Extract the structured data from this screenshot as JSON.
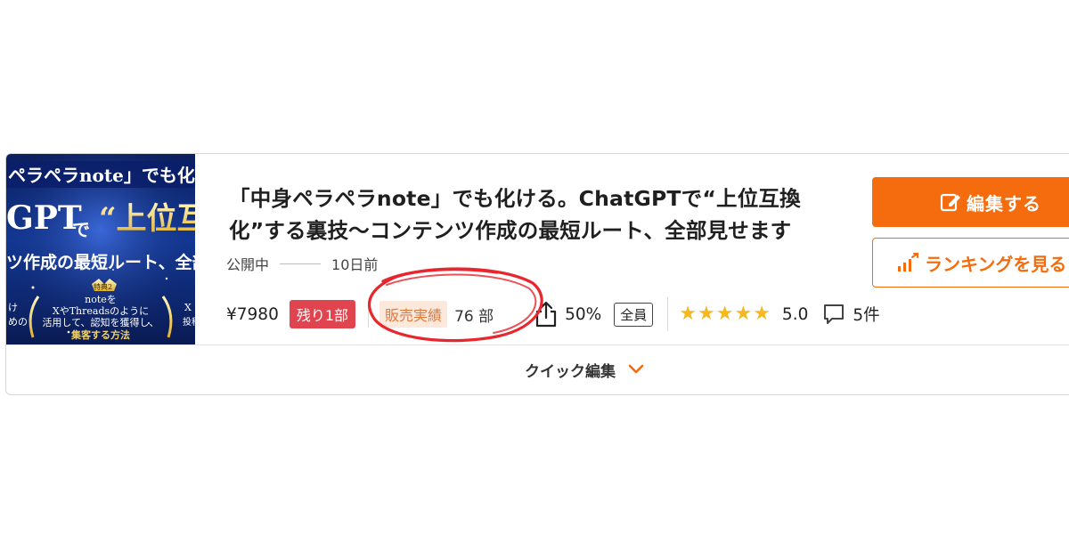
{
  "thumbnail": {
    "line1": "ペラペラnote」でも化",
    "line2": "GPT",
    "line2b": "で",
    "line2c": "“上位互",
    "line3": "ツ作成の最短ルート、全部",
    "line4": "noteを",
    "line5": "XやThreadsのように",
    "line6": "活用して、認知を獲得し、",
    "line7": "集客する方法",
    "left_fragment": "け",
    "left_fragment2": "めの",
    "right_fragment": "X",
    "right_fragment2": "投稿",
    "badge": "特典2"
  },
  "article": {
    "title": "「中身ペラペラnote」でも化ける。ChatGPTで“上位互換化”する裏技〜コンテンツ作成の最短ルート、全部見せます",
    "status": "公開中",
    "date": "10日前"
  },
  "stats": {
    "price": "¥7980",
    "remaining_badge": "残り1部",
    "sales_label": "販売実績",
    "sales_count": "76 部",
    "share_percent": "50%",
    "audience": "全員",
    "rating_stars": 5,
    "rating": "5.0",
    "comments": "5件"
  },
  "actions": {
    "edit_label": "編集する",
    "ranking_label": "ランキングを見る",
    "quick_edit_label": "クイック編集"
  },
  "colors": {
    "accent": "#f56c0e",
    "remain_badge": "#e0444e",
    "sales_badge_bg": "#fde8dc",
    "star": "#f5b91f",
    "annotation_ring": "#e8262e"
  },
  "icons": {
    "edit": "edit-icon",
    "ranking": "chart-up-icon",
    "share": "share-icon",
    "comment": "comment-icon",
    "chevron": "chevron-down-icon"
  }
}
